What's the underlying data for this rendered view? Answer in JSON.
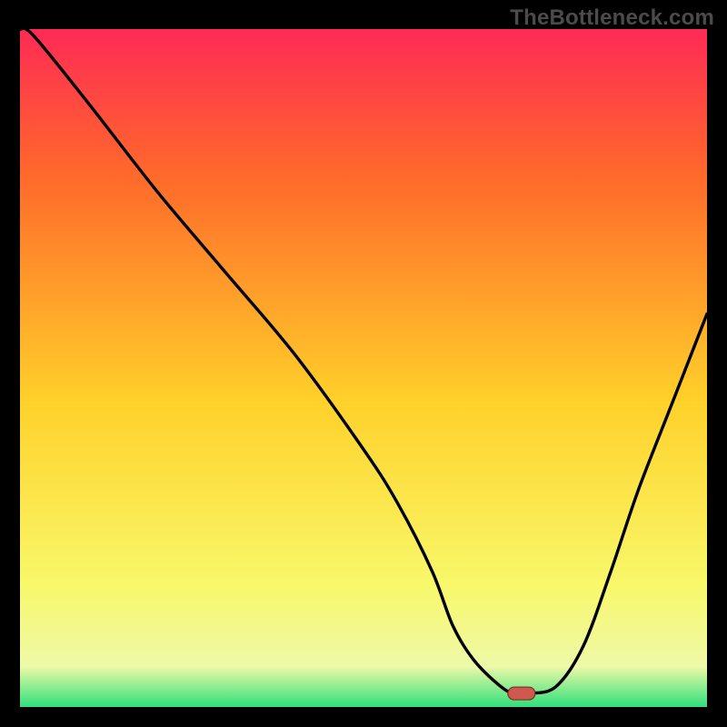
{
  "watermark": "TheBottleneck.com",
  "colors": {
    "background": "#000000",
    "watermark_text": "#4b4b4b",
    "gradient_top": "#ff2a55",
    "gradient_upper_mid": "#ff6a2a",
    "gradient_mid": "#ffd12a",
    "gradient_lower_mid": "#f8f86a",
    "gradient_near_bottom": "#eef9a8",
    "gradient_bottom": "#2fe07a",
    "curve": "#000000",
    "marker_fill": "#d1584f",
    "marker_stroke": "#7a2e26"
  },
  "chart_data": {
    "type": "line",
    "title": "",
    "xlabel": "",
    "ylabel": "",
    "xlim": [
      0,
      100
    ],
    "ylim": [
      0,
      100
    ],
    "series": [
      {
        "name": "bottleneck-curve",
        "x": [
          0,
          2,
          10,
          20,
          30,
          40,
          50,
          55,
          60,
          63,
          66,
          70,
          72,
          74,
          78,
          82,
          86,
          90,
          95,
          100
        ],
        "values": [
          100,
          99,
          89,
          76,
          64,
          52,
          38,
          30,
          20,
          12,
          7,
          3,
          2,
          2,
          3,
          9,
          20,
          32,
          45,
          58
        ]
      }
    ],
    "marker": {
      "x": 73,
      "y": 2,
      "label": ""
    }
  }
}
